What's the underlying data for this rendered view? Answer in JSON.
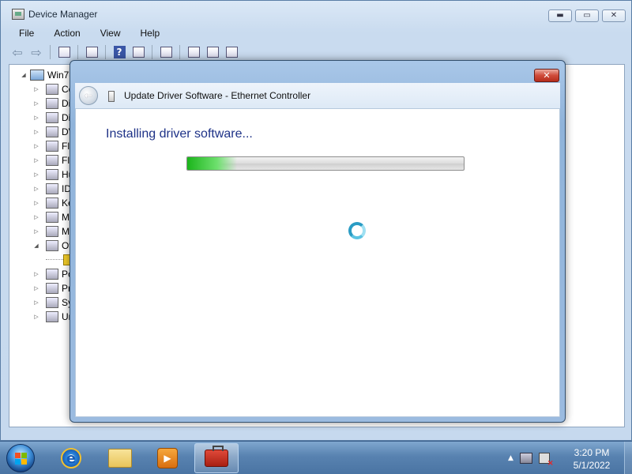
{
  "device_manager": {
    "title": "Device Manager",
    "caption_buttons": {
      "minimize": "▬",
      "maximize": "▭",
      "close": "✕"
    },
    "menu": [
      "File",
      "Action",
      "View",
      "Help"
    ],
    "tree": {
      "root_label": "Win7-",
      "items": [
        "Co",
        "Di",
        "Di",
        "DV",
        "Fl",
        "Fl",
        "Hu",
        "ID",
        "Ke",
        "M",
        "M",
        "Ot",
        "Po",
        "Pr",
        "Sy",
        "Ur"
      ]
    }
  },
  "dialog": {
    "title": "Update Driver Software - Ethernet Controller",
    "close_symbol": "✕",
    "back_symbol": "←",
    "message": "Installing driver software...",
    "progress_percent": 18
  },
  "taskbar": {
    "clock_time": "3:20 PM",
    "clock_date": "5/1/2022",
    "apps": [
      "internet-explorer",
      "windows-explorer",
      "media-player",
      "device-manager"
    ]
  }
}
